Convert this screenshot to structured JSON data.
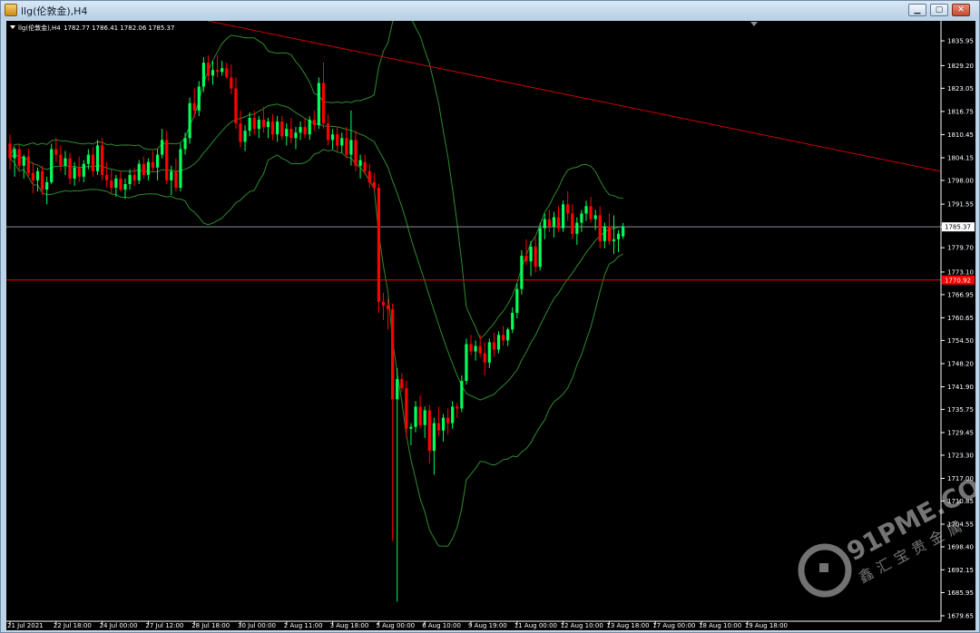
{
  "window": {
    "title": "llg(伦敦金),H4",
    "buttons": {
      "minimize": "▁",
      "restore": "▢",
      "close": "✕"
    }
  },
  "chart_header": {
    "symbol_label": "llg(伦敦金),H4",
    "ohlc_label": "1782.77 1786.41 1782.06 1785.37"
  },
  "price_labels": {
    "current": "1785.37",
    "level": "1770.92"
  },
  "watermark": {
    "brand": "91PME.COM",
    "tagline": "鑫汇宝贵金属"
  },
  "colors": {
    "bull": "#00ff5a",
    "bear": "#ff0000",
    "band": "#2f8a2f",
    "trendline": "#cc0000",
    "level_line": "#ff0000",
    "current_line": "#8a8f99",
    "background": "#000000",
    "grid_text": "#ffffff"
  },
  "chart_data": {
    "type": "candlestick",
    "symbol": "llg(伦敦金)",
    "timeframe": "H4",
    "ylim": [
      1680,
      1840
    ],
    "y_ticks": [
      1835.95,
      1829.2,
      1823.05,
      1816.75,
      1810.45,
      1804.15,
      1798.0,
      1791.55,
      1785.37,
      1779.7,
      1773.1,
      1766.95,
      1760.65,
      1754.5,
      1748.2,
      1741.9,
      1735.75,
      1729.45,
      1723.3,
      1717.0,
      1710.85,
      1704.55,
      1698.4,
      1692.15,
      1685.95,
      1679.65
    ],
    "y_tick_labels": [
      "1835.95",
      "1829.20",
      "1823.05",
      "1816.75",
      "1810.45",
      "1804.15",
      "1798.00",
      "1791.55",
      "",
      "1779.70",
      "1773.10",
      "1766.95",
      "1760.65",
      "1754.50",
      "1748.20",
      "1741.90",
      "1735.75",
      "1729.45",
      "1723.30",
      "1717.00",
      "1710.85",
      "1704.55",
      "1698.40",
      "1692.15",
      "1685.95",
      "1679.65"
    ],
    "x_labels": [
      {
        "bar": 0,
        "text": "21 Jul 2021"
      },
      {
        "bar": 10,
        "text": "22 Jul 18:00"
      },
      {
        "bar": 20,
        "text": "24 Jul 00:00"
      },
      {
        "bar": 30,
        "text": "27 Jul 12:00"
      },
      {
        "bar": 40,
        "text": "28 Jul 18:00"
      },
      {
        "bar": 50,
        "text": "30 Jul 00:00"
      },
      {
        "bar": 60,
        "text": "2 Aug 11:00"
      },
      {
        "bar": 70,
        "text": "3 Aug 18:00"
      },
      {
        "bar": 80,
        "text": "5 Aug 00:00"
      },
      {
        "bar": 90,
        "text": "6 Aug 10:00"
      },
      {
        "bar": 100,
        "text": "9 Aug 19:00"
      },
      {
        "bar": 110,
        "text": "11 Aug 00:00"
      },
      {
        "bar": 120,
        "text": "12 Aug 10:00"
      },
      {
        "bar": 130,
        "text": "13 Aug 18:00"
      },
      {
        "bar": 140,
        "text": "17 Aug 00:00"
      },
      {
        "bar": 150,
        "text": "18 Aug 10:00"
      },
      {
        "bar": 160,
        "text": "19 Aug 18:00"
      }
    ],
    "candles": [
      [
        1808.0,
        1810.5,
        1801.0,
        1804.0
      ],
      [
        1804.0,
        1807.0,
        1799.0,
        1806.5
      ],
      [
        1806.5,
        1808.0,
        1800.5,
        1802.0
      ],
      [
        1802.0,
        1805.0,
        1798.5,
        1804.5
      ],
      [
        1804.5,
        1806.5,
        1799.0,
        1800.0
      ],
      [
        1800.0,
        1803.0,
        1794.5,
        1798.0
      ],
      [
        1798.0,
        1801.5,
        1795.0,
        1800.5
      ],
      [
        1800.5,
        1802.0,
        1794.0,
        1795.5
      ],
      [
        1795.5,
        1799.0,
        1791.5,
        1797.5
      ],
      [
        1797.5,
        1808.0,
        1797.0,
        1806.5
      ],
      [
        1806.5,
        1809.5,
        1803.0,
        1805.0
      ],
      [
        1805.0,
        1807.5,
        1800.5,
        1802.0
      ],
      [
        1802.0,
        1806.0,
        1799.5,
        1804.0
      ],
      [
        1804.0,
        1805.5,
        1797.0,
        1798.5
      ],
      [
        1798.5,
        1803.0,
        1796.5,
        1801.5
      ],
      [
        1801.5,
        1804.5,
        1797.5,
        1799.0
      ],
      [
        1799.0,
        1803.5,
        1797.5,
        1802.5
      ],
      [
        1802.5,
        1806.5,
        1801.0,
        1805.0
      ],
      [
        1805.0,
        1807.0,
        1799.0,
        1800.5
      ],
      [
        1800.5,
        1809.0,
        1799.5,
        1807.5
      ],
      [
        1807.5,
        1809.5,
        1798.0,
        1799.5
      ],
      [
        1799.5,
        1803.0,
        1796.0,
        1798.0
      ],
      [
        1798.0,
        1801.0,
        1794.5,
        1796.0
      ],
      [
        1796.0,
        1799.5,
        1793.5,
        1798.5
      ],
      [
        1798.5,
        1800.5,
        1795.0,
        1795.5
      ],
      [
        1795.5,
        1798.5,
        1793.0,
        1797.0
      ],
      [
        1797.0,
        1801.0,
        1795.5,
        1799.5
      ],
      [
        1799.5,
        1801.5,
        1796.5,
        1798.0
      ],
      [
        1798.0,
        1803.5,
        1797.0,
        1802.5
      ],
      [
        1802.5,
        1804.5,
        1798.5,
        1799.5
      ],
      [
        1799.5,
        1804.0,
        1798.0,
        1803.0
      ],
      [
        1803.0,
        1806.0,
        1800.5,
        1801.5
      ],
      [
        1801.5,
        1806.5,
        1798.0,
        1805.0
      ],
      [
        1805.0,
        1812.0,
        1804.0,
        1809.0
      ],
      [
        1809.0,
        1811.5,
        1797.0,
        1798.0
      ],
      [
        1798.0,
        1802.0,
        1794.0,
        1800.5
      ],
      [
        1800.5,
        1804.0,
        1795.0,
        1796.0
      ],
      [
        1796.0,
        1808.0,
        1795.0,
        1806.5
      ],
      [
        1806.5,
        1811.0,
        1805.0,
        1809.5
      ],
      [
        1809.5,
        1820.5,
        1808.0,
        1819.0
      ],
      [
        1819.0,
        1823.0,
        1815.0,
        1817.0
      ],
      [
        1817.0,
        1825.0,
        1815.5,
        1823.5
      ],
      [
        1823.5,
        1831.5,
        1822.0,
        1830.0
      ],
      [
        1830.0,
        1832.0,
        1825.0,
        1826.5
      ],
      [
        1826.5,
        1830.5,
        1824.0,
        1828.0
      ],
      [
        1828.0,
        1832.0,
        1826.0,
        1827.5
      ],
      [
        1827.5,
        1830.5,
        1826.5,
        1828.5
      ],
      [
        1828.5,
        1830.0,
        1825.5,
        1826.0
      ],
      [
        1826.0,
        1829.5,
        1821.5,
        1823.0
      ],
      [
        1823.0,
        1826.0,
        1812.0,
        1813.5
      ],
      [
        1813.5,
        1817.0,
        1807.0,
        1808.5
      ],
      [
        1808.5,
        1813.0,
        1806.0,
        1811.5
      ],
      [
        1811.5,
        1816.5,
        1810.0,
        1815.0
      ],
      [
        1815.0,
        1817.0,
        1810.5,
        1812.0
      ],
      [
        1812.0,
        1815.5,
        1809.5,
        1814.5
      ],
      [
        1814.5,
        1818.0,
        1811.0,
        1812.5
      ],
      [
        1812.5,
        1815.0,
        1809.5,
        1814.0
      ],
      [
        1814.0,
        1816.0,
        1809.0,
        1810.5
      ],
      [
        1810.5,
        1815.5,
        1808.5,
        1814.0
      ],
      [
        1814.0,
        1815.5,
        1809.0,
        1810.0
      ],
      [
        1810.0,
        1813.5,
        1807.5,
        1812.0
      ],
      [
        1812.0,
        1815.0,
        1808.0,
        1809.5
      ],
      [
        1809.5,
        1812.5,
        1806.5,
        1811.0
      ],
      [
        1811.0,
        1814.0,
        1809.0,
        1812.5
      ],
      [
        1812.5,
        1815.0,
        1809.5,
        1810.5
      ],
      [
        1810.5,
        1815.5,
        1809.0,
        1814.5
      ],
      [
        1814.5,
        1817.0,
        1811.5,
        1813.0
      ],
      [
        1813.0,
        1826.0,
        1812.0,
        1824.5
      ],
      [
        1824.5,
        1830.0,
        1812.0,
        1813.5
      ],
      [
        1813.5,
        1816.0,
        1807.5,
        1809.0
      ],
      [
        1809.0,
        1812.0,
        1806.5,
        1810.5
      ],
      [
        1810.5,
        1812.5,
        1806.0,
        1807.5
      ],
      [
        1807.5,
        1811.0,
        1805.5,
        1809.5
      ],
      [
        1809.5,
        1812.5,
        1804.0,
        1805.0
      ],
      [
        1805.0,
        1817.0,
        1802.0,
        1809.0
      ],
      [
        1809.0,
        1811.5,
        1800.5,
        1802.0
      ],
      [
        1802.0,
        1805.0,
        1798.5,
        1803.5
      ],
      [
        1803.0,
        1805.0,
        1799.5,
        1800.5
      ],
      [
        1800.5,
        1802.5,
        1796.0,
        1797.5
      ],
      [
        1797.5,
        1800.0,
        1795.0,
        1796.0
      ],
      [
        1796.0,
        1797.0,
        1762.0,
        1765.0
      ],
      [
        1765.0,
        1767.5,
        1760.0,
        1764.0
      ],
      [
        1764.0,
        1766.0,
        1757.5,
        1763.0
      ],
      [
        1763.0,
        1764.5,
        1700.0,
        1738.5
      ],
      [
        1738.5,
        1747.0,
        1683.5,
        1744.0
      ],
      [
        1744.0,
        1745.5,
        1740.5,
        1741.5
      ],
      [
        1741.5,
        1743.5,
        1728.0,
        1730.5
      ],
      [
        1730.5,
        1732.0,
        1726.0,
        1731.0
      ],
      [
        1731.0,
        1738.0,
        1729.5,
        1736.5
      ],
      [
        1736.5,
        1739.5,
        1730.5,
        1731.5
      ],
      [
        1731.5,
        1736.5,
        1728.0,
        1735.5
      ],
      [
        1735.5,
        1737.0,
        1721.0,
        1724.5
      ],
      [
        1724.5,
        1733.5,
        1718.0,
        1732.0
      ],
      [
        1732.0,
        1736.5,
        1728.5,
        1730.0
      ],
      [
        1730.0,
        1734.5,
        1727.0,
        1733.5
      ],
      [
        1733.5,
        1736.0,
        1729.0,
        1732.0
      ],
      [
        1732.0,
        1738.0,
        1730.5,
        1736.5
      ],
      [
        1736.5,
        1737.5,
        1733.5,
        1736.0
      ],
      [
        1736.0,
        1745.0,
        1735.0,
        1743.5
      ],
      [
        1743.5,
        1755.0,
        1742.5,
        1753.5
      ],
      [
        1753.5,
        1756.0,
        1750.5,
        1751.5
      ],
      [
        1751.5,
        1754.5,
        1749.0,
        1753.0
      ],
      [
        1753.0,
        1756.0,
        1750.0,
        1751.0
      ],
      [
        1751.0,
        1754.0,
        1745.0,
        1748.5
      ],
      [
        1748.5,
        1755.0,
        1747.0,
        1754.0
      ],
      [
        1754.0,
        1756.5,
        1750.0,
        1752.0
      ],
      [
        1752.0,
        1757.0,
        1751.0,
        1756.0
      ],
      [
        1756.0,
        1758.5,
        1753.0,
        1754.5
      ],
      [
        1754.5,
        1758.0,
        1753.0,
        1757.5
      ],
      [
        1757.5,
        1763.5,
        1756.5,
        1762.0
      ],
      [
        1762.0,
        1770.0,
        1760.5,
        1768.5
      ],
      [
        1768.5,
        1779.0,
        1767.0,
        1777.5
      ],
      [
        1777.5,
        1782.0,
        1775.0,
        1776.0
      ],
      [
        1776.0,
        1781.5,
        1772.0,
        1780.0
      ],
      [
        1780.0,
        1782.5,
        1773.0,
        1774.5
      ],
      [
        1774.5,
        1786.5,
        1773.5,
        1785.0
      ],
      [
        1785.0,
        1789.0,
        1782.0,
        1787.5
      ],
      [
        1787.5,
        1790.0,
        1784.0,
        1785.5
      ],
      [
        1785.5,
        1789.5,
        1782.5,
        1788.0
      ],
      [
        1788.0,
        1791.0,
        1784.0,
        1785.0
      ],
      [
        1785.0,
        1792.5,
        1784.0,
        1791.5
      ],
      [
        1791.5,
        1795.0,
        1787.0,
        1789.0
      ],
      [
        1789.0,
        1791.5,
        1782.0,
        1783.5
      ],
      [
        1783.5,
        1788.0,
        1780.5,
        1786.5
      ],
      [
        1786.5,
        1790.0,
        1784.0,
        1789.0
      ],
      [
        1789.0,
        1792.5,
        1787.0,
        1791.0
      ],
      [
        1791.0,
        1793.5,
        1786.5,
        1787.5
      ],
      [
        1787.5,
        1790.0,
        1784.5,
        1788.5
      ],
      [
        1788.5,
        1791.0,
        1779.5,
        1781.5
      ],
      [
        1781.5,
        1786.5,
        1779.5,
        1785.5
      ],
      [
        1785.5,
        1789.0,
        1780.5,
        1781.5
      ],
      [
        1781.5,
        1788.5,
        1778.0,
        1782.0
      ],
      [
        1782.0,
        1784.5,
        1778.5,
        1783.5
      ],
      [
        1782.77,
        1786.41,
        1782.06,
        1785.37
      ]
    ]
  }
}
